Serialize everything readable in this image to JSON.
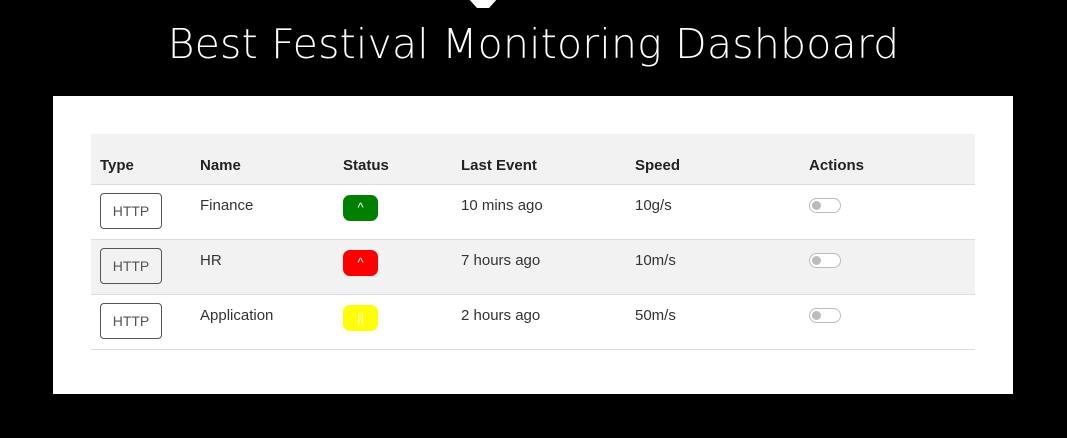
{
  "page": {
    "title": "Best Festival Monitoring Dashboard"
  },
  "table": {
    "headers": {
      "type": "Type",
      "name": "Name",
      "status": "Status",
      "last_event": "Last Event",
      "speed": "Speed",
      "actions": "Actions"
    },
    "rows": [
      {
        "type": "HTTP",
        "name": "Finance",
        "status_symbol": "^",
        "status_color": "#008000",
        "last_event": "10 mins ago",
        "speed": "10g/s"
      },
      {
        "type": "HTTP",
        "name": "HR",
        "status_symbol": "^",
        "status_color": "#ff0000",
        "last_event": "7 hours ago",
        "speed": "10m/s"
      },
      {
        "type": "HTTP",
        "name": "Application",
        "status_symbol": "||",
        "status_color": "#ffff00",
        "last_event": "2 hours ago",
        "speed": "50m/s"
      }
    ]
  },
  "colors": {
    "background": "#000000",
    "panel": "#ffffff",
    "stripe": "#f2f2f2"
  },
  "icons": {
    "actions_toggle": "toggle-switch-icon"
  }
}
